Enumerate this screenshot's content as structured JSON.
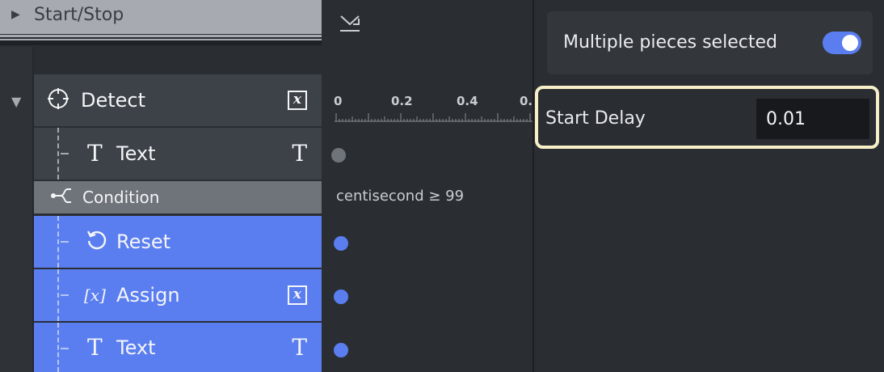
{
  "start_stop": {
    "label": "Start/Stop",
    "expander_icon": "triangle-right-icon"
  },
  "rows": {
    "detect": {
      "label": "Detect",
      "icon": "crosshair-icon",
      "right_icon": "variable-icon",
      "right_icon_text": "x"
    },
    "text1": {
      "label": "Text",
      "icon": "text-icon",
      "icon_text": "T",
      "right_icon": "text-icon",
      "right_icon_text": "T"
    },
    "condition": {
      "label": "Condition",
      "icon": "branch-icon"
    },
    "reset": {
      "label": "Reset",
      "icon": "reset-icon"
    },
    "assign": {
      "label": "Assign",
      "icon": "variable-bracket-icon",
      "icon_text": "[x]",
      "right_icon": "variable-icon",
      "right_icon_text": "x"
    },
    "text2": {
      "label": "Text",
      "icon": "text-icon",
      "icon_text": "T",
      "right_icon": "text-icon",
      "right_icon_text": "T"
    }
  },
  "timeline": {
    "ticks": [
      "0",
      "0.2",
      "0.4",
      "0."
    ],
    "condition_text": "centisecond ≥ 99",
    "dot_colors": {
      "inactive": "#6f747b",
      "active": "#5a7ef0"
    }
  },
  "panel": {
    "multiple_selected_label": "Multiple pieces selected",
    "multiple_selected_toggle_on": true,
    "start_delay_label": "Start Delay",
    "start_delay_value": "0.01"
  },
  "colors": {
    "accent": "#5a7ef0",
    "highlight_border": "#f6efc8",
    "background": "#2a2e33"
  }
}
